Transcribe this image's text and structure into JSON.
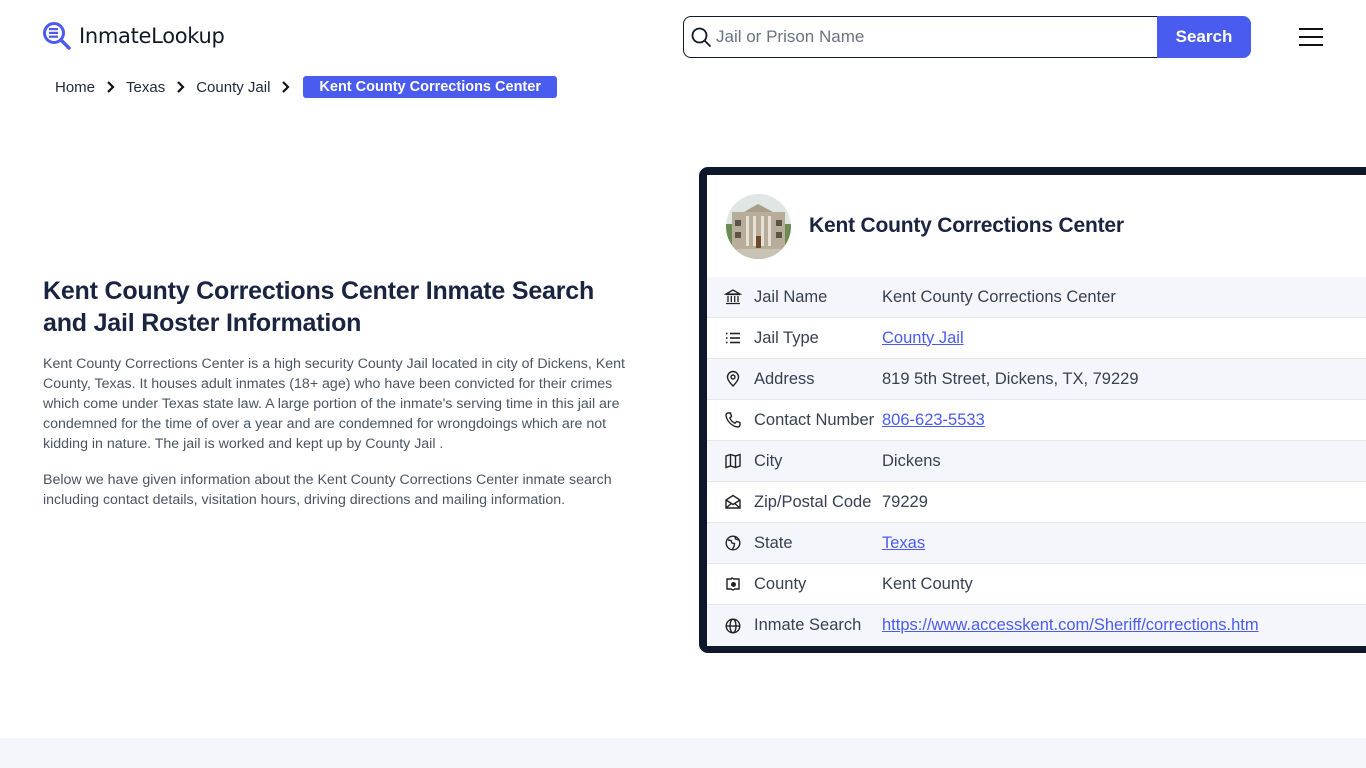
{
  "brand": {
    "name": "InmateLookup",
    "accent_color": "#4a5cf0",
    "dark_color": "#0f172a"
  },
  "search": {
    "placeholder": "Jail or Prison Name",
    "value": "",
    "button_label": "Search"
  },
  "breadcrumb": {
    "items": [
      {
        "label": "Home"
      },
      {
        "label": "Texas"
      },
      {
        "label": "County Jail"
      }
    ],
    "current": "Kent County Corrections Center"
  },
  "main": {
    "title": "Kent County Corrections Center Inmate Search and Jail Roster Information",
    "paragraphs": [
      "Kent County Corrections Center is a high security County Jail located in city of Dickens, Kent County, Texas. It houses adult inmates (18+ age) who have been convicted for their crimes which come under Texas state law. A large portion of the inmate's serving time in this jail are condemned for the time of over a year and are condemned for wrongdoings which are not kidding in nature. The jail is worked and kept up by County Jail .",
      "Below we have given information about the Kent County Corrections Center inmate search including contact details, visitation hours, driving directions and mailing information."
    ]
  },
  "card": {
    "title": "Kent County Corrections Center",
    "image_alt": "courthouse-building-photo",
    "rows": [
      {
        "icon": "bank-building-icon",
        "label": "Jail Name",
        "value": "Kent County Corrections Center",
        "link": false
      },
      {
        "icon": "list-icon",
        "label": "Jail Type",
        "value": "County Jail",
        "link": true
      },
      {
        "icon": "map-pin-icon",
        "label": "Address",
        "value": "819 5th Street, Dickens, TX, 79229",
        "link": false
      },
      {
        "icon": "phone-icon",
        "label": "Contact Number",
        "value": "806-623-5533",
        "link": true
      },
      {
        "icon": "map-icon",
        "label": "City",
        "value": "Dickens",
        "link": false
      },
      {
        "icon": "mail-open-icon",
        "label": "Zip/Postal Code",
        "value": "79229",
        "link": false
      },
      {
        "icon": "globe-americas-icon",
        "label": "State",
        "value": "Texas",
        "link": true
      },
      {
        "icon": "county-map-icon",
        "label": "County",
        "value": "Kent County",
        "link": false
      },
      {
        "icon": "globe-icon",
        "label": "Inmate Search",
        "value": "https://www.accesskent.com/Sheriff/corrections.htm",
        "link": true
      }
    ]
  }
}
